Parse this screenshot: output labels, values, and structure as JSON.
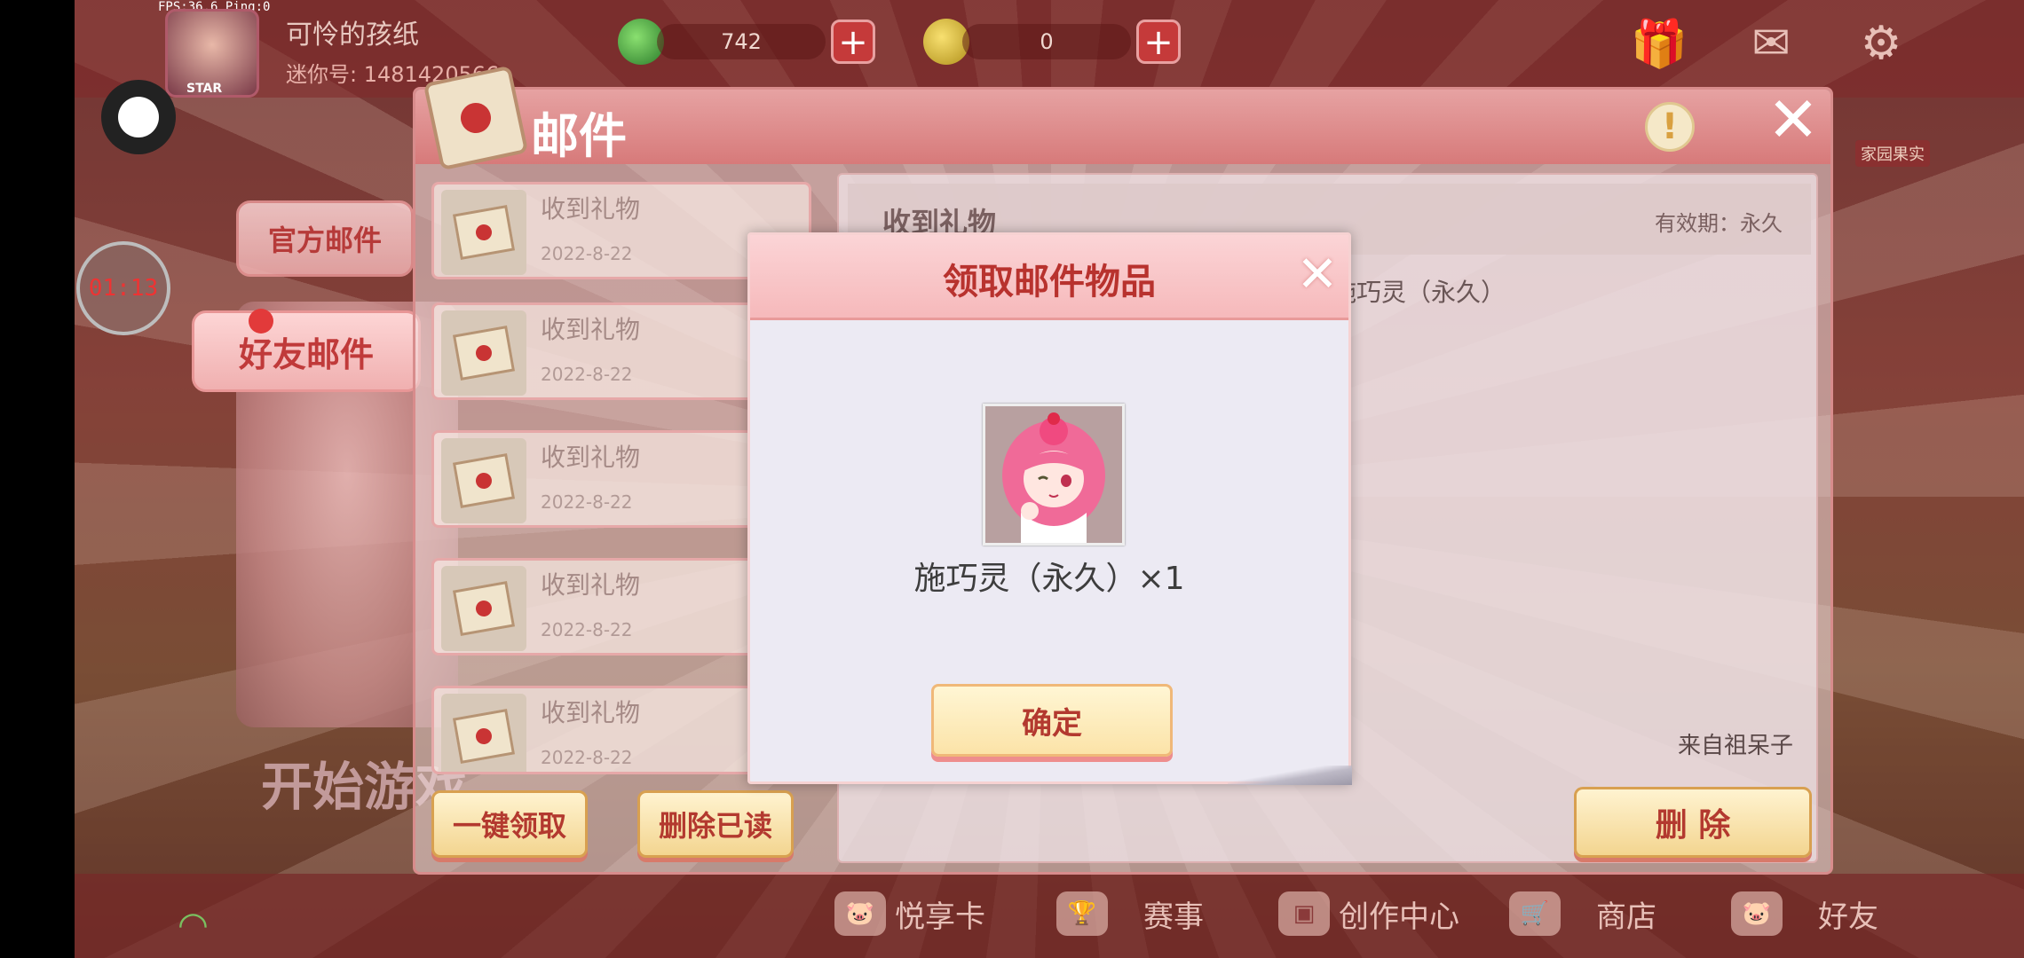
{
  "hud": {
    "fps_text": "FPS:36.6  Ping:0",
    "player_name": "可怜的孩纸",
    "mini_id": "迷你号: 1481420566",
    "star_label": "STAR",
    "currency1_amount": "742",
    "currency2_amount": "0",
    "timer": "01:13",
    "event_label": "家园果实",
    "start_game": "开始游戏"
  },
  "mail": {
    "title": "邮件",
    "tabs": {
      "official": "官方邮件",
      "friends": "好友邮件"
    },
    "items": [
      {
        "title": "收到礼物",
        "date": "2022-8-22"
      },
      {
        "title": "收到礼物",
        "date": "2022-8-22"
      },
      {
        "title": "收到礼物",
        "date": "2022-8-22"
      },
      {
        "title": "收到礼物",
        "date": "2022-8-22"
      },
      {
        "title": "收到礼物",
        "date": "2022-8-22"
      }
    ],
    "claim_all": "一键领取",
    "delete_read": "删除已读",
    "delete": "删 除",
    "detail": {
      "title": "收到礼物",
      "validity": "有效期：永久",
      "item_text": "施巧灵（永久）",
      "from": "来自祖呆子"
    }
  },
  "modal": {
    "title": "领取邮件物品",
    "reward_name": "施巧灵（永久）×1",
    "confirm": "确定"
  },
  "bottom_nav": {
    "card": "悦享卡",
    "match": "赛事",
    "create": "创作中心",
    "shop": "商店",
    "friends": "好友"
  },
  "colors": {
    "accent_red": "#b8322e",
    "header_pink": "#f6b9bb",
    "button_tan": "#fbe3a8"
  }
}
